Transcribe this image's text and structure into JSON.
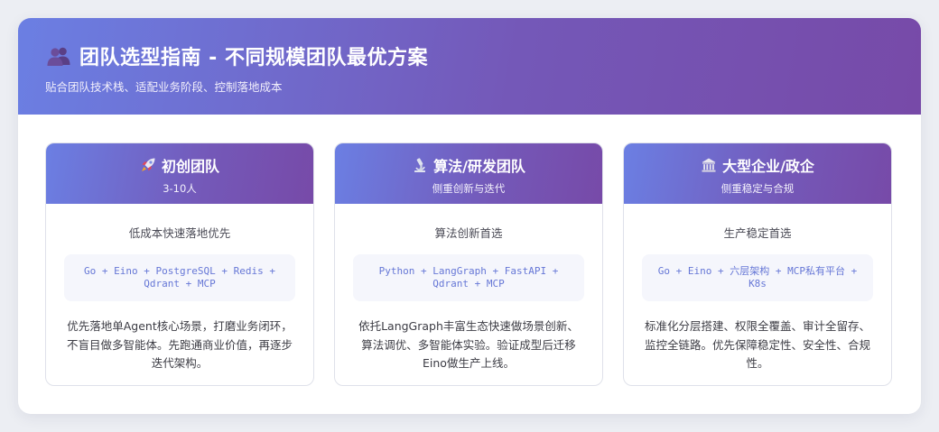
{
  "header": {
    "icon": "people-icon",
    "title": "团队选型指南 - 不同规模团队最优方案",
    "subtitle": "贴合团队技术栈、适配业务阶段、控制落地成本"
  },
  "cards": [
    {
      "icon": "rocket-icon",
      "title": "初创团队",
      "subtitle": "3-10人",
      "tagline": "低成本快速落地优先",
      "stack": "Go + Eino + PostgreSQL + Redis + Qdrant + MCP",
      "description": "优先落地单Agent核心场景，打磨业务闭环，不盲目做多智能体。先跑通商业价值，再逐步迭代架构。"
    },
    {
      "icon": "microscope-icon",
      "title": "算法/研发团队",
      "subtitle": "侧重创新与迭代",
      "tagline": "算法创新首选",
      "stack": "Python + LangGraph + FastAPI + Qdrant + MCP",
      "description": "依托LangGraph丰富生态快速做场景创新、算法调优、多智能体实验。验证成型后迁移Eino做生产上线。"
    },
    {
      "icon": "classical-building-icon",
      "title": "大型企业/政企",
      "subtitle": "侧重稳定与合规",
      "tagline": "生产稳定首选",
      "stack": "Go + Eino + 六层架构 + MCP私有平台 + K8s",
      "description": "标准化分层搭建、权限全覆盖、审计全留存、监控全链路。优先保障稳定性、安全性、合规性。"
    }
  ],
  "colors": {
    "gradient_start": "#6b7fe3",
    "gradient_end": "#774aa8",
    "stack_text": "#6677d6",
    "stack_bg": "#f5f6fc"
  }
}
